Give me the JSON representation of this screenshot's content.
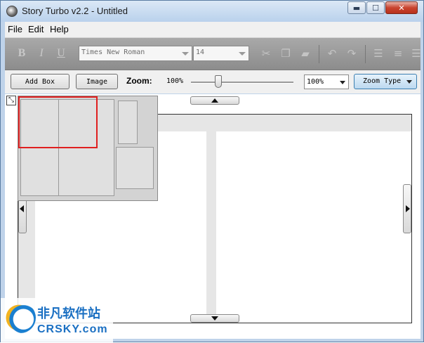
{
  "window": {
    "title": "Story Turbo v2.2 - Untitled",
    "controls": {
      "minimize": "▬",
      "maximize": "☐",
      "close": "✕"
    }
  },
  "menu": {
    "items": [
      "File",
      "Edit",
      "Help"
    ]
  },
  "format_toolbar": {
    "bold": "B",
    "italic": "I",
    "underline": "U",
    "font_family": "Times New Roman",
    "font_size": "14",
    "icons": [
      "cut-icon",
      "copy-icon",
      "paste-icon",
      "undo-icon",
      "redo-icon",
      "align-left-icon",
      "align-center-icon",
      "align-right-icon"
    ]
  },
  "zoom_toolbar": {
    "add_box_label": "Add Box",
    "image_label": "Image",
    "zoom_label": "Zoom:",
    "zoom_readout": "100%",
    "zoom_level": 0.25,
    "zoom_combo_value": "100%",
    "zoom_type_label": "Zoom Type"
  },
  "watermark": {
    "cn": "非凡软件站",
    "en": "CRSKY.com"
  },
  "colors": {
    "viewport_highlight": "#e02020",
    "toolbar_bg": "#9a9a9a"
  }
}
